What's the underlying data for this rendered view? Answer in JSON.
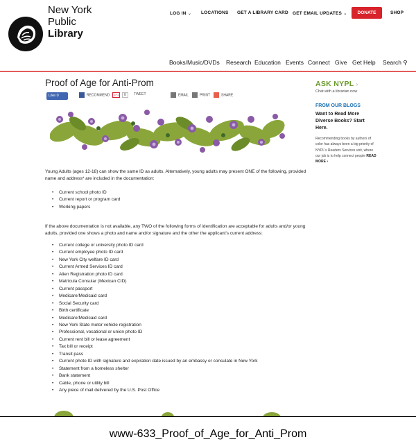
{
  "brand": {
    "line1": "New York",
    "line2": "Public",
    "line3": "Library"
  },
  "top_nav": {
    "login": "LOG IN",
    "locations": "LOCATIONS",
    "library_card": "GET A LIBRARY CARD",
    "email_updates": "GET EMAIL UPDATES",
    "donate": "DONATE",
    "shop": "SHOP"
  },
  "main_nav": [
    "Books/Music/DVDs",
    "Research",
    "Education",
    "Events",
    "Connect",
    "Give",
    "Get Help",
    "Search"
  ],
  "page_title": "Proof of Age for Anti-Prom",
  "share": {
    "like": "Like 0",
    "recommend": "RECOMMEND",
    "gplus_count": "0",
    "tweet": "TWEET",
    "email": "EMAIL",
    "print": "PRINT",
    "share": "SHARE"
  },
  "intro": "Young Adults (ages 12-18) can show the same ID as adults. Alternatively, young adults may present ONE of the following, provided name and address* are included in the documentation:",
  "list1": [
    "Current school photo ID",
    "Current report or program card",
    "Working papers"
  ],
  "para2": "If the above documentation is not available, any TWO of the following forms of identification are acceptable for adults and/or young adults, provided one shows a photo and name and/or signature and the other the applicant's current address:",
  "list2": [
    "Current college or university photo ID card",
    "Current employee photo ID card",
    "New York City welfare ID card",
    "Current Armed Services ID card",
    "Alien Registration photo ID card",
    "Matricula Consular (Mexican CID)",
    "Current passport",
    "Medicare/Medicaid card",
    "Social Security card",
    "Birth certificate",
    "Medicare/Medicaid card",
    "New York State motor vehicle registration",
    "Professional, vocational or union photo ID",
    "Current rent bill or lease agreement",
    "Tax bill or receipt",
    "Transit pass",
    "Current photo ID with signature and expiration date issued by an embassy or consulate in New York",
    "Statement from a homeless shelter",
    "Bank statement",
    "Cable, phone or utility bill",
    "Any piece of mail delivered by the U.S. Post Office"
  ],
  "sidebar": {
    "ask": "ASK NYPL",
    "ask_sub": "Chat with a librarian now",
    "from_blogs": "FROM OUR BLOGS",
    "blog_title": "Want to Read More Diverse Books? Start Here.",
    "blog_text": "Recommending books by authors of color has always been a big priority of NYPL's Readers Services unit, where our job is to help connect people",
    "read_more": "READ MORE ›"
  },
  "caption": "www-633_Proof_of_Age_for_Anti_Prom",
  "colors": {
    "accent_red": "#d8232a",
    "link_blue": "#1a6fb5",
    "ask_green": "#6a9a2a"
  }
}
